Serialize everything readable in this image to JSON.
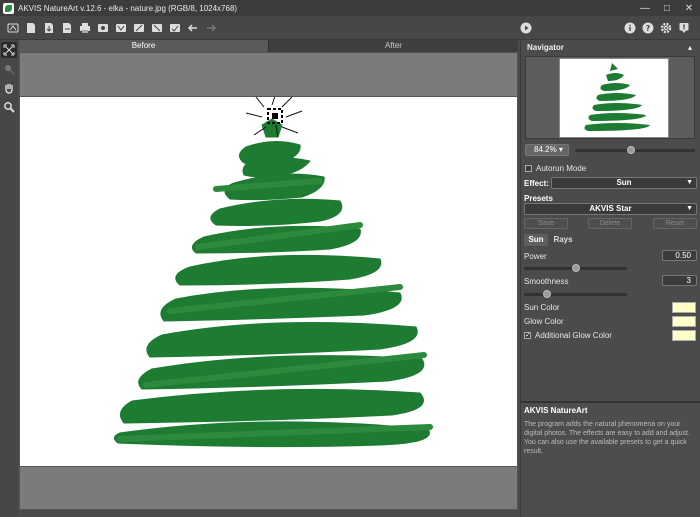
{
  "titlebar": {
    "title": "AKVIS NatureArt v.12.6 - elka - nature.jpg (RGB/8, 1024x768)"
  },
  "canvas": {
    "tab_before": "Before",
    "tab_after": "After"
  },
  "panel": {
    "navigator_title": "Navigator",
    "zoom": "84.2%",
    "zoom_arrow": "▾",
    "autorun_label": "Autorun Mode",
    "effect_label": "Effect:",
    "effect_value": "Sun",
    "presets_title": "Presets",
    "preset_value": "AKVIS Star",
    "save_btn": "Save",
    "delete_btn": "Delete",
    "reset_btn": "Reset",
    "tab_sun": "Sun",
    "tab_rays": "Rays",
    "power_label": "Power",
    "power_value": "0.50",
    "power_level": 0.5,
    "smoothness_label": "Smoothness",
    "smoothness_value": "3",
    "smoothness_level": 0.22,
    "sun_color_label": "Sun Color",
    "glow_color_label": "Glow Color",
    "additional_glow_label": "Additional Glow Color",
    "additional_glow_checked": "✓",
    "info_title": "AKVIS NatureArt",
    "info_text": "The program adds the natural phenomena on your digital photos. The effects are easy to add and adjust. You can also use the available presets to get a quick result."
  },
  "colors": {
    "tree": "#1e7b32",
    "swatch": "#ffffc8",
    "accent_dark": "#333333"
  }
}
